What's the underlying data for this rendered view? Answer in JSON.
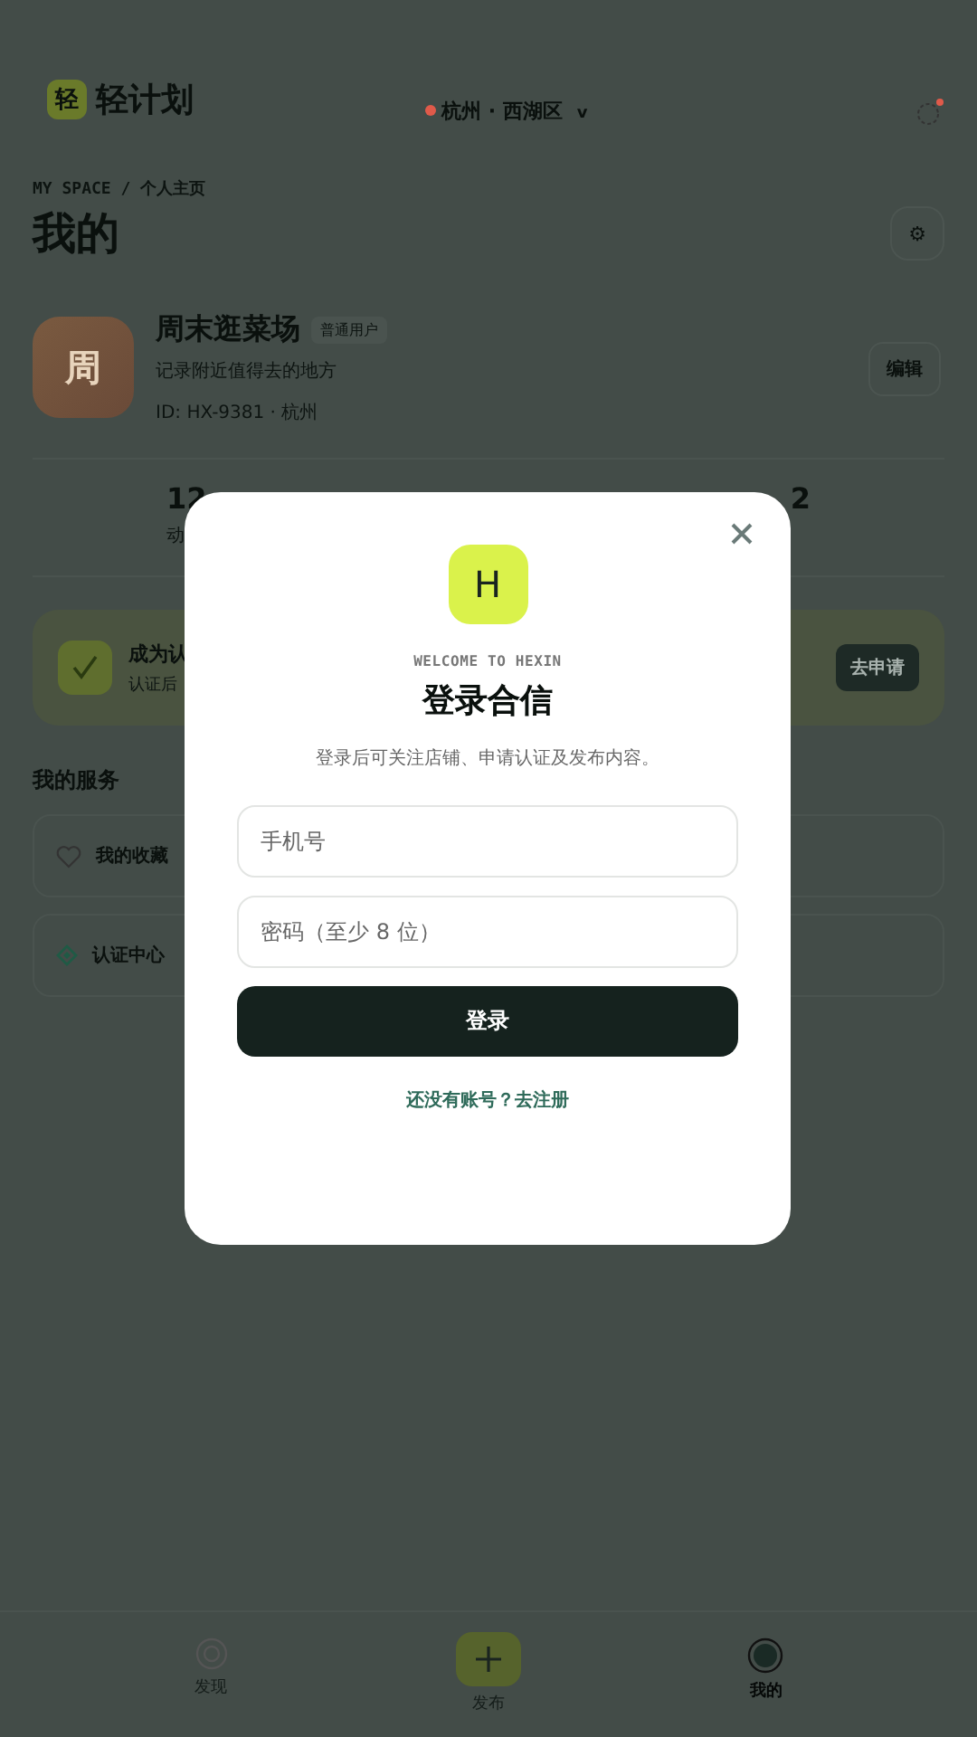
{
  "header": {
    "brand_mark": "轻",
    "brand": "轻计划",
    "location": "杭州 · 西湖区",
    "location_caret": "v"
  },
  "breadcrumb": "MY SPACE / 个人主页",
  "page_title": "我的",
  "settings_icon": "⚙",
  "profile": {
    "avatar": "周",
    "name": "周末逛菜场",
    "tag": "普通用户",
    "bio": "记录附近值得去的地方",
    "meta": "ID: HX-9381 · 杭州",
    "edit": "编辑"
  },
  "stats": [
    {
      "value": "12",
      "label": "动"
    },
    {
      "value": "2"
    }
  ],
  "banner": {
    "title": "成为认",
    "subtitle": "认证后",
    "button": "去申请"
  },
  "services_title": "我的服务",
  "services": [
    {
      "kind": "heart",
      "label": "我的收藏"
    },
    {
      "kind": "diamond",
      "label": "认证中心"
    }
  ],
  "tabbar": [
    {
      "kind": "discover",
      "label": "发现",
      "selected": false
    },
    {
      "kind": "publish",
      "label": "发布",
      "selected": false
    },
    {
      "kind": "me",
      "label": "我的",
      "selected": true
    }
  ],
  "login_dialog": {
    "logo": "H",
    "eyebrow": "WELCOME TO HEXIN",
    "title": "登录合信",
    "description": "登录后可关注店铺、申请认证及发布内容。",
    "fields": [
      {
        "placeholder": "手机号"
      },
      {
        "placeholder": "密码（至少 8 位）"
      }
    ],
    "submit": "登录",
    "register_link": "还没有账号？去注册"
  }
}
